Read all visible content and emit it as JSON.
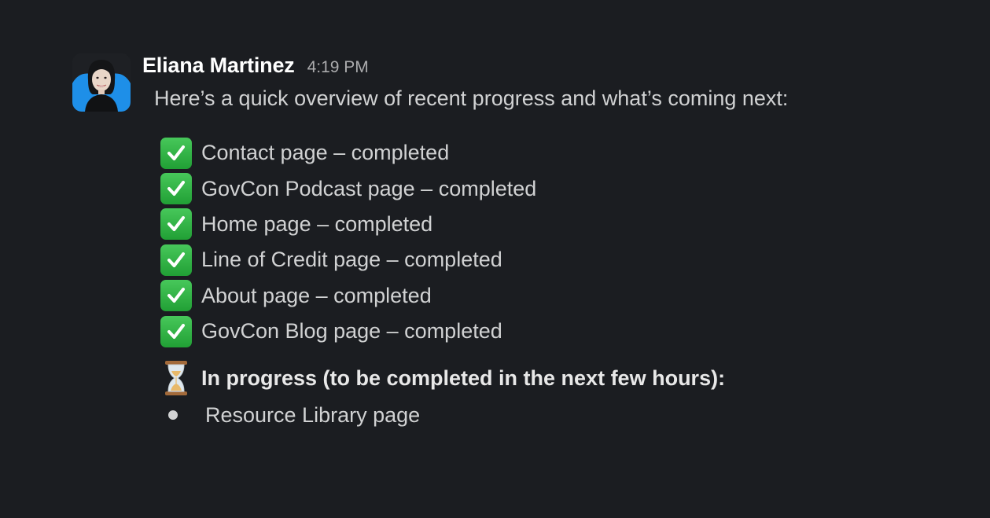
{
  "message": {
    "author": "Eliana Martinez",
    "timestamp": "4:19 PM",
    "intro": "Here’s a quick overview of recent progress and what’s coming next:",
    "completed_items": [
      {
        "icon": "check-mark-icon",
        "label": "Contact page – completed"
      },
      {
        "icon": "check-mark-icon",
        "label": "GovCon Podcast page – completed"
      },
      {
        "icon": "check-mark-icon",
        "label": "Home page – completed"
      },
      {
        "icon": "check-mark-icon",
        "label": "Line of Credit page – completed"
      },
      {
        "icon": "check-mark-icon",
        "label": "About page – completed"
      },
      {
        "icon": "check-mark-icon",
        "label": "GovCon Blog page – completed"
      }
    ],
    "in_progress": {
      "icon": "hourglass-icon",
      "heading": "In progress (to be completed in the next few hours):",
      "items": [
        "Resource Library page"
      ]
    }
  },
  "colors": {
    "background": "#1b1d21",
    "author": "#ffffff",
    "text": "#d1d2d3",
    "timestamp": "#ababad",
    "check_green": "#2fb344"
  }
}
